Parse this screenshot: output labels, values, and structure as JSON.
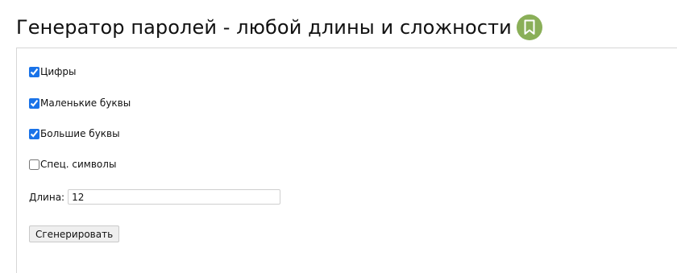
{
  "header": {
    "title": "Генератор паролей - любой длины и сложности",
    "bookmark_icon": "bookmark-icon",
    "badge_color": "#8aaf58"
  },
  "options": [
    {
      "label": "Цифры",
      "checked": true
    },
    {
      "label": "Маленькие буквы",
      "checked": true
    },
    {
      "label": "Большие буквы",
      "checked": true
    },
    {
      "label": "Спец. символы",
      "checked": false
    }
  ],
  "length": {
    "label": "Длина:",
    "value": "12"
  },
  "generate_button": {
    "label": "Сгенерировать"
  }
}
